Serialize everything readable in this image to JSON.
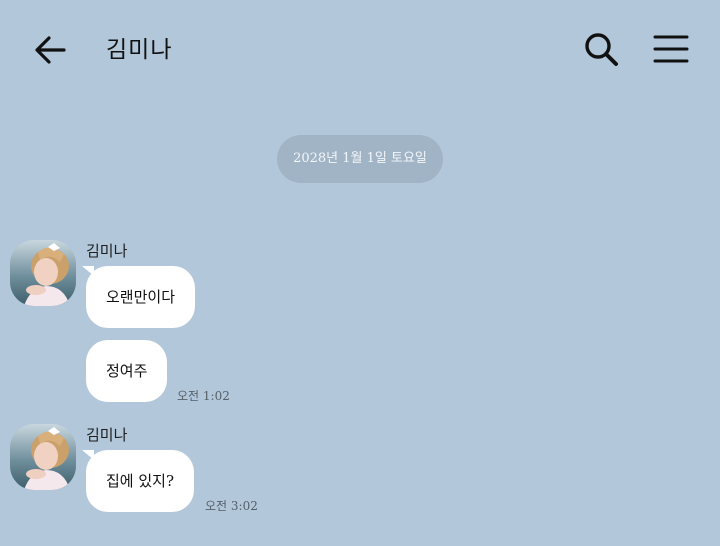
{
  "header": {
    "title": "김미나",
    "back_icon": "arrow-left-icon",
    "search_icon": "search-icon",
    "menu_icon": "hamburger-menu-icon"
  },
  "date_divider": "2028년 1월 1일 토요일",
  "messages": [
    {
      "sender": "김미나",
      "text": "오랜만이다"
    },
    {
      "text": "정여주",
      "time": "오전 1:02"
    },
    {
      "sender": "김미나",
      "text": "집에 있지?",
      "time": "오전 3:02"
    }
  ],
  "colors": {
    "background": "#b2c7da",
    "bubble": "#ffffff",
    "date_pill": "#a1b4c5"
  }
}
